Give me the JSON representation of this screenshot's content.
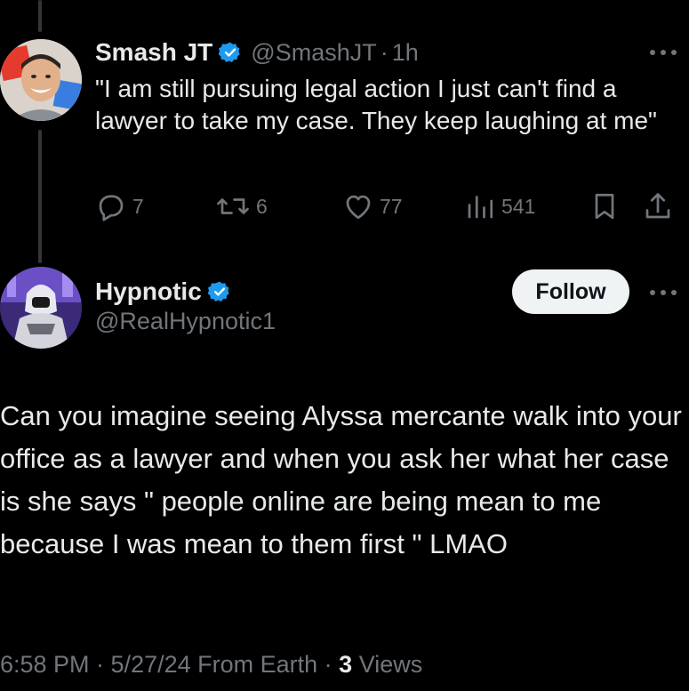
{
  "reply_parent": {
    "display_name": "Smash JT",
    "handle": "@SmashJT",
    "separator": "·",
    "time": "1h",
    "text": "\"I am still pursuing legal action I just can't find a lawyer to take my case. They keep laughing at me\"",
    "stats": {
      "replies": "7",
      "reposts": "6",
      "likes": "77",
      "views": "541"
    }
  },
  "main_tweet": {
    "display_name": "Hypnotic",
    "handle": "@RealHypnotic1",
    "follow_label": "Follow",
    "text": "Can you imagine seeing Alyssa mercante walk into your office as a lawyer and when you ask her what her case is she says \" people online are being mean to me because I was mean to them first \" LMAO",
    "timestamp": "6:58 PM · 5/27/24 From Earth · ",
    "views_count": "3",
    "views_label": " Views"
  },
  "colors": {
    "background": "#000000",
    "text_primary": "#e7e9ea",
    "text_secondary": "#71767b",
    "verified_blue": "#1d9bf0",
    "follow_button_bg": "#eff3f4"
  },
  "icons": {
    "verified": "verified-badge-icon",
    "more": "more-options-icon",
    "reply": "reply-icon",
    "repost": "repost-icon",
    "like": "heart-icon",
    "views": "views-chart-icon",
    "bookmark": "bookmark-icon",
    "share": "share-icon"
  }
}
